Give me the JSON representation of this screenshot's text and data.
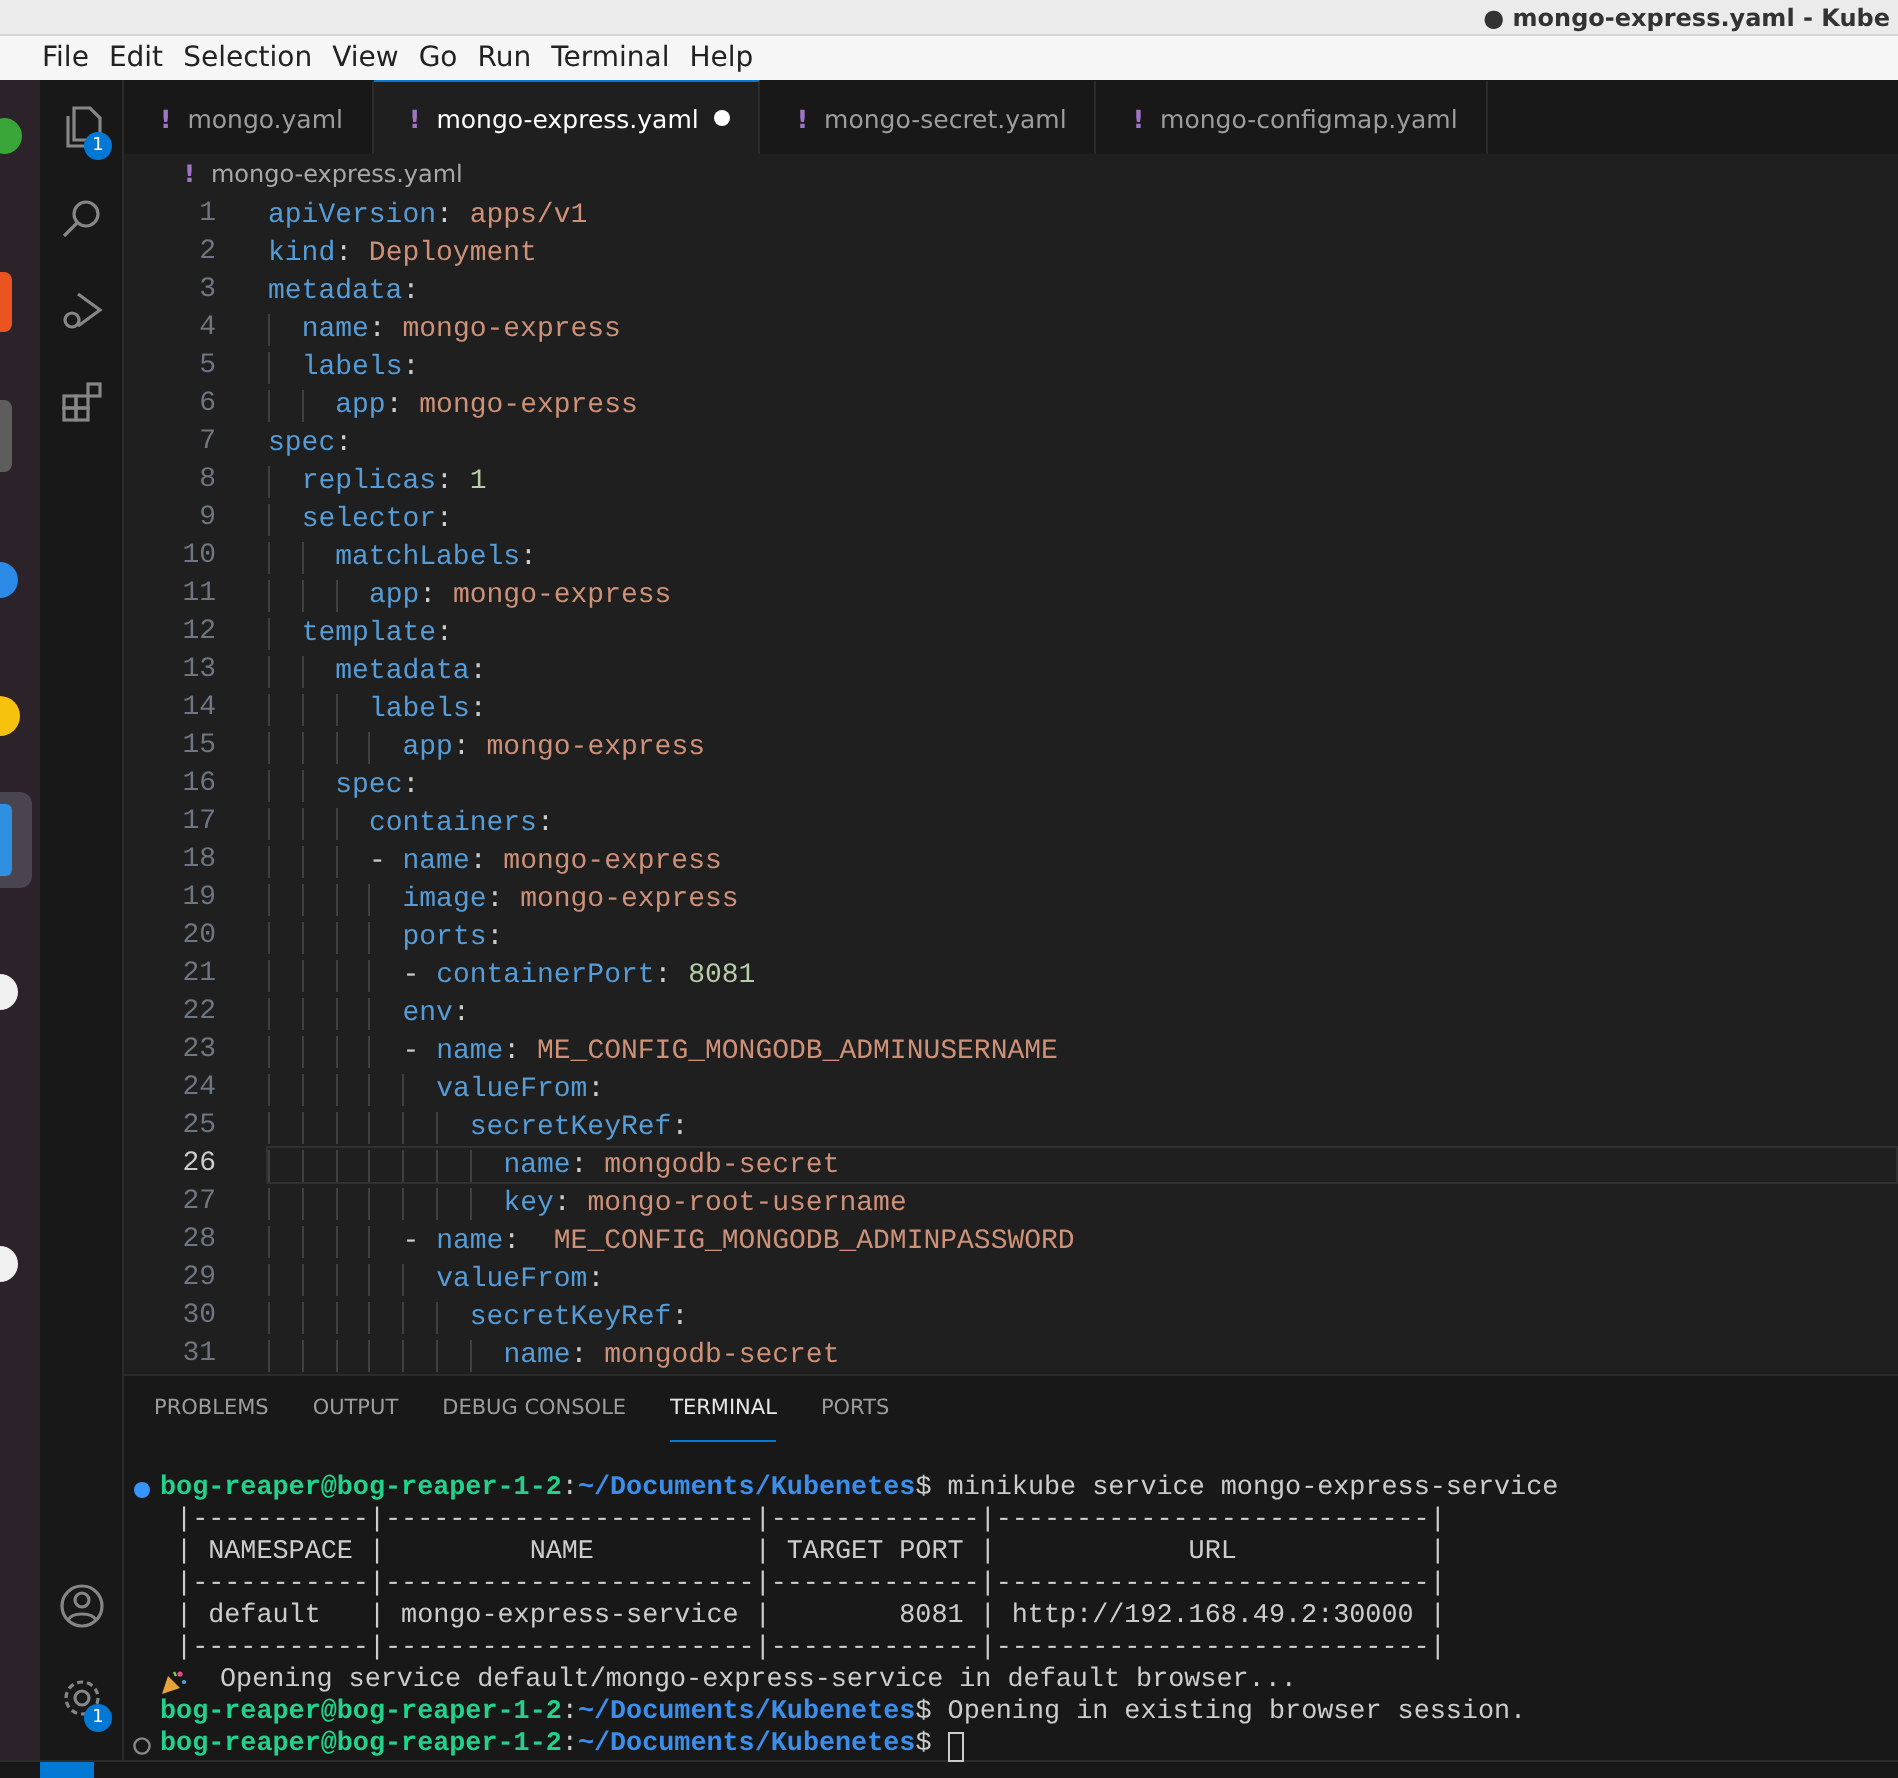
{
  "window": {
    "title": "● mongo-express.yaml - Kube"
  },
  "menu": [
    "File",
    "Edit",
    "Selection",
    "View",
    "Go",
    "Run",
    "Terminal",
    "Help"
  ],
  "activity_bar": {
    "top": [
      {
        "kind": "explorer",
        "badge": "1"
      },
      {
        "kind": "search"
      },
      {
        "kind": "debug"
      },
      {
        "kind": "extensions"
      }
    ],
    "bottom": [
      {
        "kind": "account"
      },
      {
        "kind": "settings",
        "badge": "1"
      }
    ]
  },
  "tabs": [
    {
      "icon": "!",
      "label": "mongo.yaml",
      "selected": false,
      "modified": false
    },
    {
      "icon": "!",
      "label": "mongo-express.yaml",
      "selected": true,
      "modified": true
    },
    {
      "icon": "!",
      "label": "mongo-secret.yaml",
      "selected": false,
      "modified": false
    },
    {
      "icon": "!",
      "label": "mongo-configmap.yaml",
      "selected": false,
      "modified": false
    }
  ],
  "breadcrumb": {
    "icon": "!",
    "label": "mongo-express.yaml"
  },
  "editor": {
    "lines": [
      {
        "number": "1",
        "text": "apiVersion: apps/v1",
        "current": false
      },
      {
        "number": "2",
        "text": "kind: Deployment",
        "current": false
      },
      {
        "number": "3",
        "text": "metadata:",
        "current": false
      },
      {
        "number": "4",
        "text": "  name: mongo-express",
        "current": false
      },
      {
        "number": "5",
        "text": "  labels:",
        "current": false
      },
      {
        "number": "6",
        "text": "    app: mongo-express",
        "current": false
      },
      {
        "number": "7",
        "text": "spec:",
        "current": false
      },
      {
        "number": "8",
        "text": "  replicas: 1",
        "current": false
      },
      {
        "number": "9",
        "text": "  selector:",
        "current": false
      },
      {
        "number": "10",
        "text": "    matchLabels:",
        "current": false
      },
      {
        "number": "11",
        "text": "      app: mongo-express",
        "current": false
      },
      {
        "number": "12",
        "text": "  template:",
        "current": false
      },
      {
        "number": "13",
        "text": "    metadata:",
        "current": false
      },
      {
        "number": "14",
        "text": "      labels:",
        "current": false
      },
      {
        "number": "15",
        "text": "        app: mongo-express",
        "current": false
      },
      {
        "number": "16",
        "text": "    spec:",
        "current": false
      },
      {
        "number": "17",
        "text": "      containers:",
        "current": false
      },
      {
        "number": "18",
        "text": "      - name: mongo-express",
        "current": false
      },
      {
        "number": "19",
        "text": "        image: mongo-express",
        "current": false
      },
      {
        "number": "20",
        "text": "        ports:",
        "current": false
      },
      {
        "number": "21",
        "text": "        - containerPort: 8081",
        "current": false
      },
      {
        "number": "22",
        "text": "        env:",
        "current": false
      },
      {
        "number": "23",
        "text": "        - name: ME_CONFIG_MONGODB_ADMINUSERNAME",
        "current": false
      },
      {
        "number": "24",
        "text": "          valueFrom:",
        "current": false
      },
      {
        "number": "25",
        "text": "            secretKeyRef:",
        "current": false
      },
      {
        "number": "26",
        "text": "              name: mongodb-secret",
        "current": true
      },
      {
        "number": "27",
        "text": "              key: mongo-root-username",
        "current": false
      },
      {
        "number": "28",
        "text": "        - name:  ME_CONFIG_MONGODB_ADMINPASSWORD",
        "current": false
      },
      {
        "number": "29",
        "text": "          valueFrom:",
        "current": false
      },
      {
        "number": "30",
        "text": "            secretKeyRef:",
        "current": false
      },
      {
        "number": "31",
        "text": "              name: mongodb-secret",
        "current": false
      }
    ]
  },
  "panel": {
    "tabs": [
      {
        "label": "PROBLEMS",
        "selected": false
      },
      {
        "label": "OUTPUT",
        "selected": false
      },
      {
        "label": "DEBUG CONSOLE",
        "selected": false
      },
      {
        "label": "TERMINAL",
        "selected": true
      },
      {
        "label": "PORTS",
        "selected": false
      }
    ],
    "terminal": [
      {
        "kind": "prompt",
        "decoration": true,
        "completed": true,
        "user": "bog-reaper@bog-reaper-1-2",
        "sep": ":",
        "path": "~/Documents/Kubenetes",
        "symbol": "$",
        "command": "minikube service mongo-express-service",
        "cursor": false
      },
      {
        "kind": "output",
        "text": " |-----------|-----------------------|-------------|---------------------------|"
      },
      {
        "kind": "output",
        "text": " | NAMESPACE |         NAME          | TARGET PORT |            URL            |"
      },
      {
        "kind": "output",
        "text": " |-----------|-----------------------|-------------|---------------------------|"
      },
      {
        "kind": "output",
        "text": " | default   | mongo-express-service |        8081 | http://192.168.49.2:30000 |"
      },
      {
        "kind": "output",
        "text": " |-----------|-----------------------|-------------|---------------------------|"
      },
      {
        "kind": "notice",
        "text": "Opening service default/mongo-express-service in default browser..."
      },
      {
        "kind": "prompt",
        "decoration": false,
        "user": "bog-reaper@bog-reaper-1-2",
        "sep": ":",
        "path": "~/Documents/Kubenetes",
        "symbol": "$",
        "command": "Opening in existing browser session.",
        "cursor": false
      },
      {
        "kind": "prompt",
        "decoration": true,
        "completed": false,
        "user": "bog-reaper@bog-reaper-1-2",
        "sep": ":",
        "path": "~/Documents/Kubenetes",
        "symbol": "$",
        "cursor": true
      }
    ]
  }
}
